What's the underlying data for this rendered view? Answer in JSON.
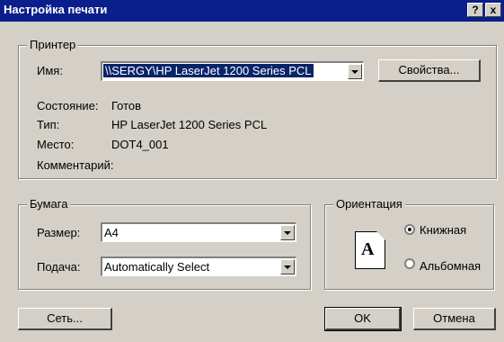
{
  "window": {
    "title": "Настройка печати"
  },
  "titlebar": {
    "help": "?",
    "close": "x"
  },
  "printer": {
    "group_label": "Принтер",
    "name_label": "Имя:",
    "name_value": "\\\\SERGY\\HP LaserJet 1200 Series PCL",
    "properties_button": "Свойства...",
    "status_label": "Состояние:",
    "status_value": "Готов",
    "type_label": "Тип:",
    "type_value": "HP LaserJet 1200 Series PCL",
    "location_label": "Место:",
    "location_value": "DOT4_001",
    "comment_label": "Комментарий:"
  },
  "paper": {
    "group_label": "Бумага",
    "size_label": "Размер:",
    "size_value": "A4",
    "source_label": "Подача:",
    "source_value": "Automatically Select"
  },
  "orientation": {
    "group_label": "Ориентация",
    "icon_letter": "A",
    "portrait": "Книжная",
    "landscape": "Альбомная",
    "selected": "portrait"
  },
  "buttons": {
    "network": "Сеть...",
    "ok": "OK",
    "cancel": "Отмена"
  }
}
